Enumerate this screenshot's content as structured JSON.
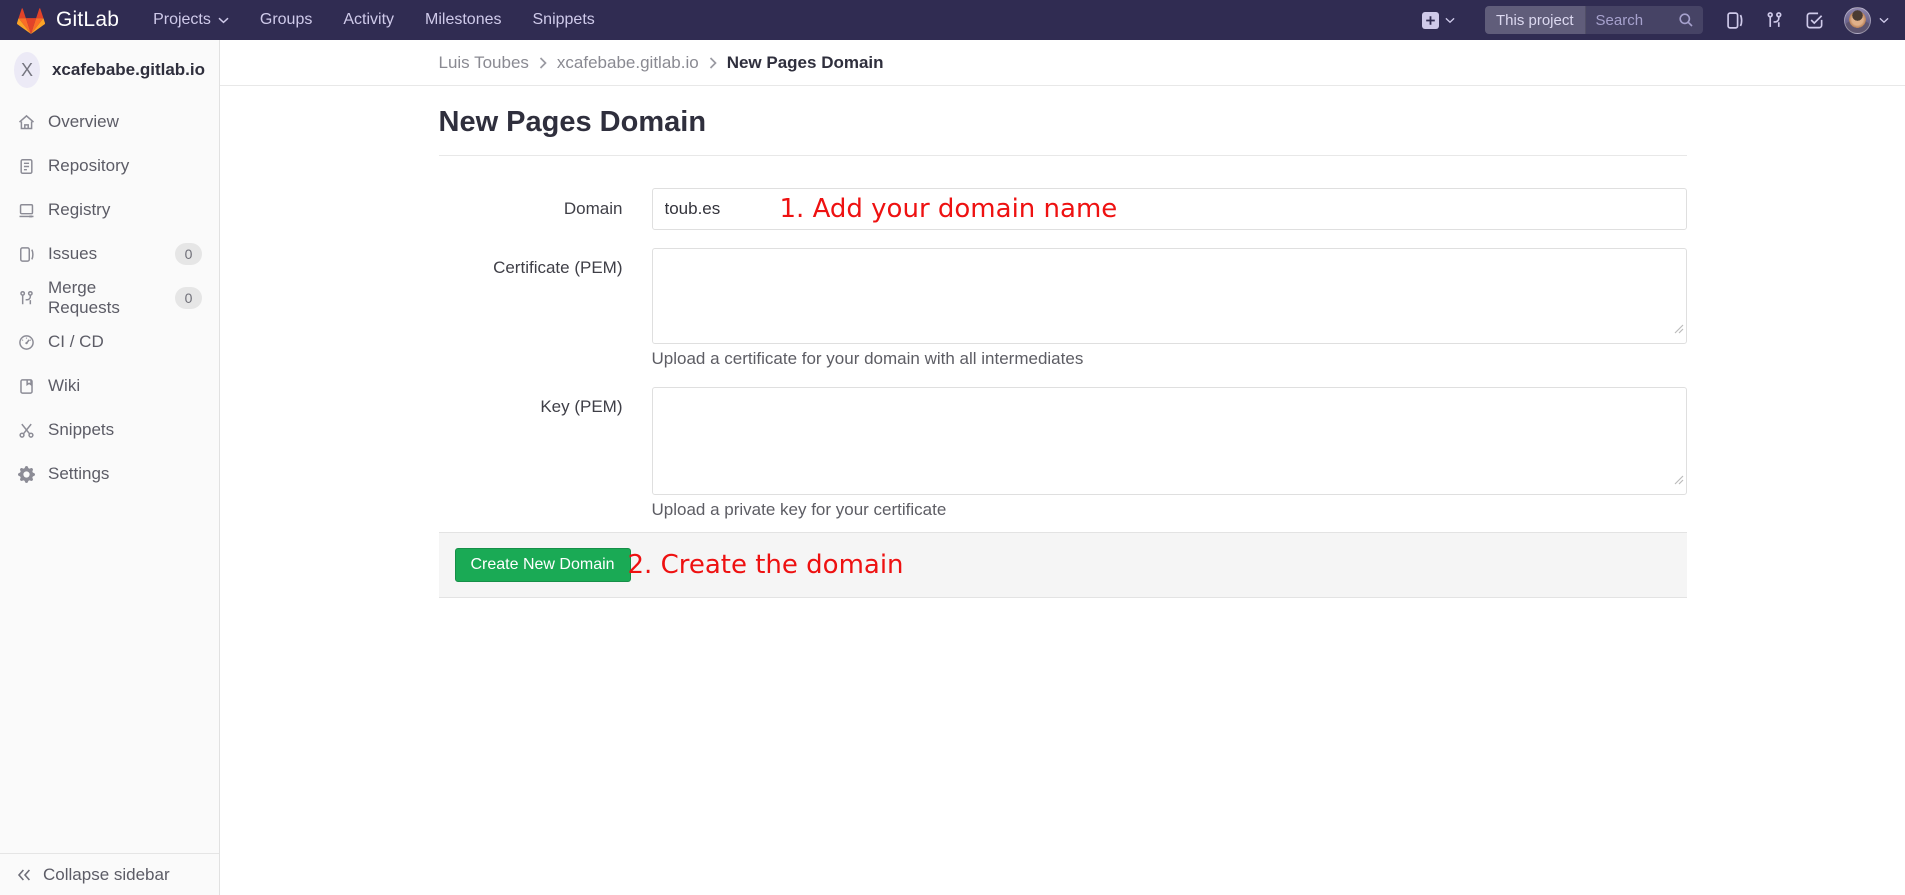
{
  "theme": {
    "navbar_bg": "#302c52",
    "navbar_text": "#cfcaea",
    "accent_green": "#1aaa55",
    "accent_green_border": "#168f48",
    "annotation_red": "#ee1111",
    "sidebar_bg": "#fafafa"
  },
  "navbar": {
    "logo_text": "GitLab",
    "items": [
      {
        "label": "Projects",
        "caret": true
      },
      {
        "label": "Groups"
      },
      {
        "label": "Activity"
      },
      {
        "label": "Milestones"
      },
      {
        "label": "Snippets"
      }
    ],
    "search": {
      "scope": "This project",
      "placeholder": "Search"
    },
    "action_icons": [
      "plus-menu-icon",
      "issues-icon",
      "merge-requests-icon",
      "todos-icon",
      "user-avatar"
    ]
  },
  "sidebar": {
    "project": {
      "initial": "X",
      "name": "xcafebabe.gitlab.io"
    },
    "items": [
      {
        "label": "Overview",
        "icon": "home-icon"
      },
      {
        "label": "Repository",
        "icon": "document-icon"
      },
      {
        "label": "Registry",
        "icon": "monitor-icon"
      },
      {
        "label": "Issues",
        "icon": "issue-cards-icon",
        "badge": "0"
      },
      {
        "label": "Merge Requests",
        "icon": "git-branch-icon",
        "badge": "0"
      },
      {
        "label": "CI / CD",
        "icon": "gauge-icon"
      },
      {
        "label": "Wiki",
        "icon": "book-icon"
      },
      {
        "label": "Snippets",
        "icon": "scissors-icon"
      },
      {
        "label": "Settings",
        "icon": "gear-icon"
      }
    ],
    "collapse_label": "Collapse sidebar"
  },
  "breadcrumb": {
    "items": [
      "Luis Toubes",
      "xcafebabe.gitlab.io",
      "New Pages Domain"
    ]
  },
  "page": {
    "title": "New Pages Domain",
    "form": {
      "domain": {
        "label": "Domain",
        "value": "toub.es"
      },
      "certificate": {
        "label": "Certificate (PEM)",
        "value": "",
        "help": "Upload a certificate for your domain with all intermediates"
      },
      "key": {
        "label": "Key (PEM)",
        "value": "",
        "help": "Upload a private key for your certificate"
      },
      "submit_label": "Create New Domain"
    },
    "annotations": [
      {
        "step": "1",
        "text": "1. Add your domain name"
      },
      {
        "step": "2",
        "text": "2. Create the domain"
      }
    ]
  }
}
